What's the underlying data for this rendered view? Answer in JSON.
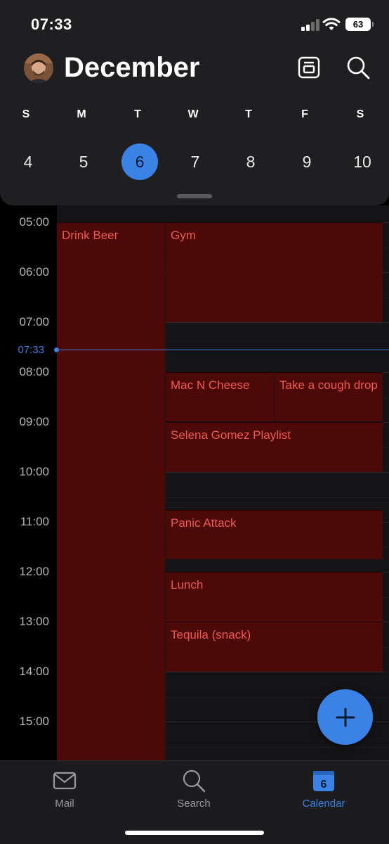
{
  "status_bar": {
    "time": "07:33",
    "battery": "63"
  },
  "header": {
    "month": "December",
    "day_view_icon": "day-view-icon",
    "search_icon": "search-icon"
  },
  "week": {
    "weekdays": [
      "S",
      "M",
      "T",
      "W",
      "T",
      "F",
      "S"
    ],
    "dates": [
      "4",
      "5",
      "6",
      "7",
      "8",
      "9",
      "10"
    ],
    "selected_index": 2
  },
  "timeline": {
    "hours": [
      "05:00",
      "06:00",
      "07:00",
      "08:00",
      "09:00",
      "10:00",
      "11:00",
      "12:00",
      "13:00",
      "14:00",
      "15:00"
    ],
    "now_label": "07:33",
    "events": [
      {
        "title": "Drink Beer"
      },
      {
        "title": "Gym"
      },
      {
        "title": "Mac N Cheese"
      },
      {
        "title": "Take a cough drop"
      },
      {
        "title": "Selena Gomez Playlist"
      },
      {
        "title": "Panic Attack"
      },
      {
        "title": "Lunch"
      },
      {
        "title": "Tequila (snack)"
      }
    ]
  },
  "tab_bar": {
    "mail": "Mail",
    "search": "Search",
    "calendar": "Calendar",
    "calendar_badge": "6"
  },
  "colors": {
    "accent": "#3a82e6",
    "event_bg": "#4d0808",
    "event_text": "#ee5a52"
  }
}
